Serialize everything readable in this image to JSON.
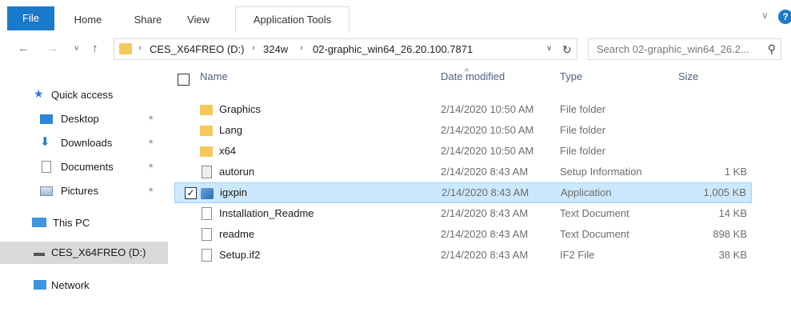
{
  "ribbon": {
    "tabs": [
      "File",
      "Home",
      "Share",
      "View",
      "Application Tools"
    ],
    "minimize_glyph": "∨",
    "help_glyph": "?"
  },
  "address": {
    "crumbs": [
      "CES_X64FREO (D:)",
      "324w",
      "02-graphic_win64_26.20.100.7871"
    ],
    "separator": "›"
  },
  "search": {
    "placeholder": "Search 02-graphic_win64_26.2..."
  },
  "nav": {
    "items": [
      {
        "label": "Quick access",
        "icon": "star-icon"
      },
      {
        "label": "Desktop",
        "icon": "desktop-icon",
        "pinned": true
      },
      {
        "label": "Downloads",
        "icon": "downloads-icon",
        "pinned": true
      },
      {
        "label": "Documents",
        "icon": "documents-icon",
        "pinned": true
      },
      {
        "label": "Pictures",
        "icon": "pictures-icon",
        "pinned": true
      },
      {
        "label": "This PC",
        "icon": "computer-icon"
      },
      {
        "label": "CES_X64FREO (D:)",
        "icon": "drive-icon",
        "selected": true
      },
      {
        "label": "Network",
        "icon": "network-icon"
      }
    ]
  },
  "columns": {
    "name": "Name",
    "date": "Date modified",
    "type": "Type",
    "size": "Size"
  },
  "files": [
    {
      "name": "Graphics",
      "date": "2/14/2020 10:50 AM",
      "type": "File folder",
      "size": "",
      "icon": "folder-icon"
    },
    {
      "name": "Lang",
      "date": "2/14/2020 10:50 AM",
      "type": "File folder",
      "size": "",
      "icon": "folder-icon"
    },
    {
      "name": "x64",
      "date": "2/14/2020 10:50 AM",
      "type": "File folder",
      "size": "",
      "icon": "folder-icon"
    },
    {
      "name": "autorun",
      "date": "2/14/2020 8:43 AM",
      "type": "Setup Information",
      "size": "1 KB",
      "icon": "setup-info-icon"
    },
    {
      "name": "igxpin",
      "date": "2/14/2020 8:43 AM",
      "type": "Application",
      "size": "1,005 KB",
      "icon": "application-icon",
      "selected": true
    },
    {
      "name": "Installation_Readme",
      "date": "2/14/2020 8:43 AM",
      "type": "Text Document",
      "size": "14 KB",
      "icon": "text-document-icon"
    },
    {
      "name": "readme",
      "date": "2/14/2020 8:43 AM",
      "type": "Text Document",
      "size": "898 KB",
      "icon": "text-document-icon"
    },
    {
      "name": "Setup.if2",
      "date": "2/14/2020 8:43 AM",
      "type": "IF2 File",
      "size": "38 KB",
      "icon": "text-document-icon"
    }
  ],
  "colors": {
    "accent": "#1979ca",
    "selection_bg": "#cce8ff",
    "selection_border": "#99d1ff",
    "folder": "#f4c85a"
  }
}
